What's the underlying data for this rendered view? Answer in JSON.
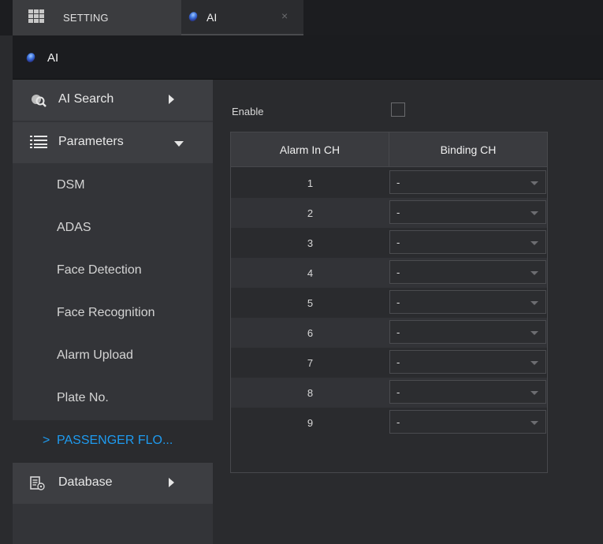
{
  "tabs": [
    {
      "label": "SETTING",
      "icon": "grid-icon"
    },
    {
      "label": "AI",
      "icon": "ai-orb-icon",
      "close": "×"
    }
  ],
  "title": {
    "label": "AI",
    "icon": "ai-orb-icon"
  },
  "sidebar": {
    "ai_search": {
      "label": "AI Search",
      "icon": "ai-search-icon"
    },
    "parameters": {
      "label": "Parameters",
      "icon": "list-icon"
    },
    "items": [
      {
        "label": "DSM"
      },
      {
        "label": "ADAS"
      },
      {
        "label": "Face Detection"
      },
      {
        "label": "Face Recognition"
      },
      {
        "label": "Alarm Upload"
      },
      {
        "label": "Plate No."
      },
      {
        "label": "PASSENGER FLO...",
        "active": true,
        "chevron": ">"
      }
    ],
    "database": {
      "label": "Database",
      "icon": "database-icon"
    }
  },
  "main": {
    "enable_label": "Enable",
    "enable_checked": false,
    "table": {
      "headers": [
        "Alarm In CH",
        "Binding CH"
      ],
      "rows": [
        {
          "ch": "1",
          "binding": "-"
        },
        {
          "ch": "2",
          "binding": "-"
        },
        {
          "ch": "3",
          "binding": "-"
        },
        {
          "ch": "4",
          "binding": "-"
        },
        {
          "ch": "5",
          "binding": "-"
        },
        {
          "ch": "6",
          "binding": "-"
        },
        {
          "ch": "7",
          "binding": "-"
        },
        {
          "ch": "8",
          "binding": "-"
        },
        {
          "ch": "9",
          "binding": "-"
        }
      ]
    }
  },
  "colors": {
    "accent": "#1e9bf0",
    "background": "#2a2b2e",
    "sidebar": "#333438",
    "header": "#1b1c1f"
  }
}
